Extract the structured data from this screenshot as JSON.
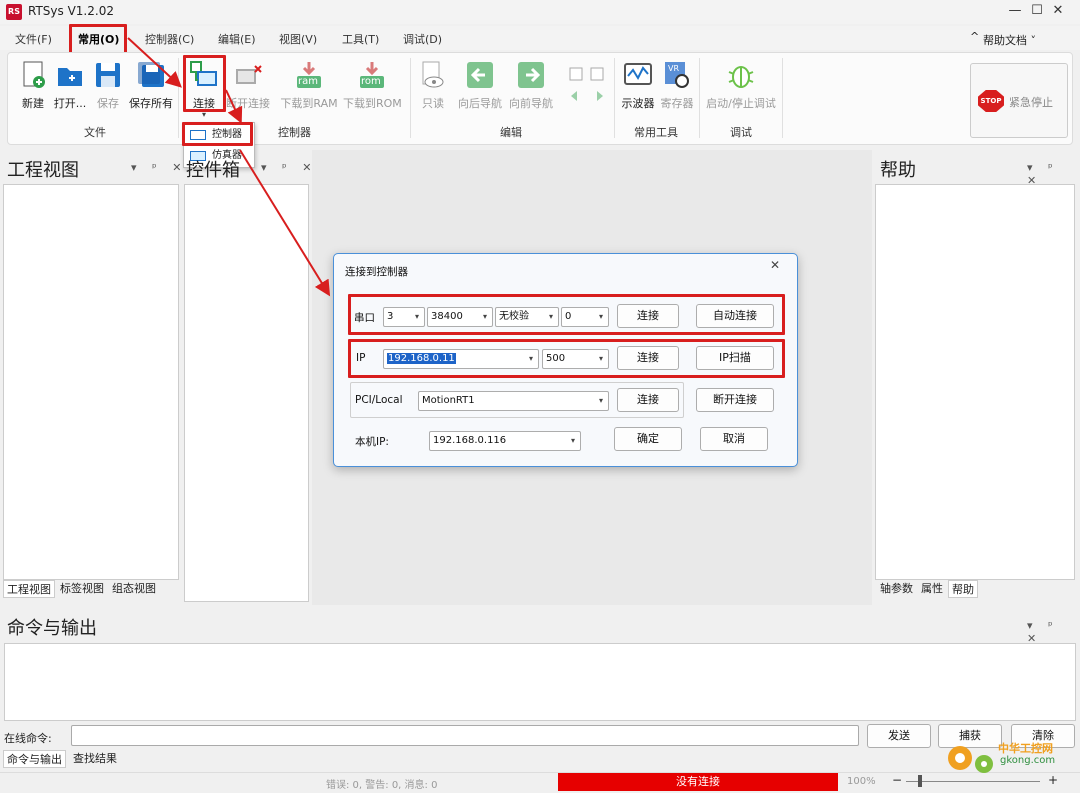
{
  "app": {
    "title": "RTSys V1.2.02",
    "logo_text": "RS"
  },
  "window_controls": {
    "minimize": "—",
    "maximize": "☐",
    "close": "✕"
  },
  "menu": {
    "items": [
      "文件(F)",
      "常用(O)",
      "控制器(C)",
      "编辑(E)",
      "视图(V)",
      "工具(T)",
      "调试(D)"
    ],
    "collapse": "^",
    "help_docs": "帮助文档 ˅"
  },
  "ribbon": {
    "file": {
      "new": "新建",
      "open": "打开...",
      "save": "保存",
      "save_all": "保存所有",
      "group": "文件"
    },
    "controller": {
      "connect": "连接",
      "disconnect": "断开连接",
      "download_ram": "下载到RAM",
      "download_rom": "下载到ROM",
      "ram_badge": "ram",
      "rom_badge": "rom",
      "group": "控制器"
    },
    "edit": {
      "readonly": "只读",
      "back_nav": "向后导航",
      "forward_nav": "向前导航",
      "group": "编辑"
    },
    "tools": {
      "oscilloscope": "示波器",
      "register": "寄存器",
      "group": "常用工具",
      "vr_badge": "VR"
    },
    "debug": {
      "start_stop": "启动/停止调试",
      "group": "调试"
    },
    "emergency": {
      "label": "紧急停止",
      "badge": "STOP"
    }
  },
  "connect_dropdown": {
    "items": [
      "控制器",
      "仿真器"
    ]
  },
  "panels": {
    "project": {
      "title": "工程视图",
      "tabs": [
        "工程视图",
        "标签视图",
        "组态视图"
      ]
    },
    "controller": {
      "title": "控件箱"
    },
    "help": {
      "title": "帮助",
      "tabs": [
        "轴参数",
        "属性",
        "帮助"
      ]
    },
    "controls": "▾ ᵖ ✕",
    "output": {
      "title": "命令与输出",
      "cmd_label": "在线命令:",
      "send": "发送",
      "capture": "捕获",
      "clear": "清除",
      "tabs": [
        "命令与输出",
        "查找结果"
      ]
    }
  },
  "dialog": {
    "title": "连接到控制器",
    "close": "✕",
    "serial": {
      "label": "串口",
      "port": "3",
      "baud": "38400",
      "parity": "无校验",
      "stop": "0",
      "connect": "连接",
      "auto_connect": "自动连接"
    },
    "ip": {
      "label": "IP",
      "address": "192.168.0.11",
      "port": "500",
      "connect": "连接",
      "scan": "IP扫描"
    },
    "pci": {
      "label": "PCI/Local",
      "value": "MotionRT1",
      "connect": "连接",
      "disconnect": "断开连接"
    },
    "local_ip": {
      "label": "本机IP:",
      "value": "192.168.0.116",
      "ok": "确定",
      "cancel": "取消"
    }
  },
  "status": {
    "messages": "错误: 0, 警告: 0, 消息: 0",
    "connection": "没有连接",
    "zoom": "100%",
    "minus": "−",
    "plus": "+"
  },
  "watermark": {
    "brand": "中华工控网",
    "domain": "gkong.com"
  },
  "colors": {
    "red_annotation": "#d81e1e",
    "status_red": "#e60000",
    "dialog_border": "#4a90d9",
    "ip_select": "#1e64c8"
  }
}
